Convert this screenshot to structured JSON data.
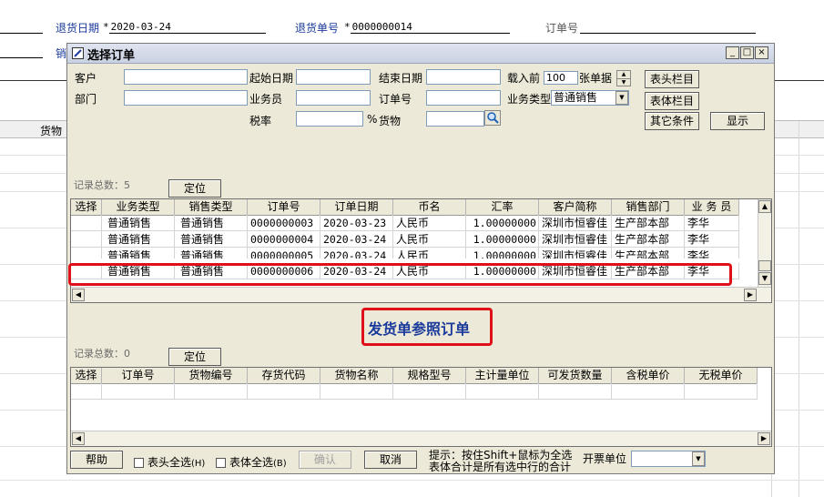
{
  "background_form": {
    "return_date_label": "退货日期",
    "return_date_value": "2020-03-24",
    "return_no_label": "退货单号",
    "return_no_value": "0000000014",
    "order_no_label": "订单号",
    "sales_label_partial": "销",
    "goods_col_label": "货物",
    "required_mark": "*"
  },
  "dialog": {
    "title": "选择订单",
    "window_buttons": [
      "_",
      "□",
      "×"
    ],
    "filters": {
      "customer_label": "客户",
      "customer_value": "",
      "ship_start_label": "起始日期",
      "ship_start_value": "",
      "end_date_label": "结束日期",
      "end_date_value": "",
      "load_prefix_label": "载入前",
      "load_count": "100",
      "load_suffix_label": "张单据",
      "department_label": "部门",
      "department_value": "",
      "salesperson_label": "业务员",
      "salesperson_value": "",
      "order_no_label": "订单号",
      "order_no_value": "",
      "business_type_label": "业务类型",
      "business_type_value": "普通销售",
      "tax_rate_label": "税率",
      "tax_rate_value": "",
      "percent": "%",
      "goods_label": "货物",
      "goods_value": ""
    },
    "buttons": {
      "header_columns": "表头栏目",
      "body_columns": "表体栏目",
      "other_conditions": "其它条件",
      "show": "显示",
      "locate_top": "定位",
      "locate_bottom": "定位",
      "help": "帮助",
      "confirm": "确认",
      "cancel": "取消"
    },
    "top_record_count": "记录总数：5",
    "bottom_record_count": "记录总数：0",
    "top_grid": {
      "headers": [
        "选择",
        "业务类型",
        "销售类型",
        "订单号",
        "订单日期",
        "币名",
        "汇率",
        "客户简称",
        "销售部门",
        "业 务 员"
      ],
      "rows": [
        [
          "",
          "普通销售",
          "普通销售",
          "0000000003",
          "2020-03-23",
          "人民币",
          "1.00000000",
          "深圳市恒睿佳",
          "生产部本部",
          "李华"
        ],
        [
          "",
          "普通销售",
          "普通销售",
          "0000000004",
          "2020-03-24",
          "人民币",
          "1.00000000",
          "深圳市恒睿佳",
          "生产部本部",
          "李华"
        ],
        [
          "",
          "普通销售",
          "普通销售",
          "0000000005",
          "2020-03-24",
          "人民币",
          "1.00000000",
          "深圳市恒睿佳",
          "生产部本部",
          "李华"
        ],
        [
          "",
          "普通销售",
          "普通销售",
          "0000000006",
          "2020-03-24",
          "人民币",
          "1.00000000",
          "深圳市恒睿佳",
          "生产部本部",
          "李华"
        ]
      ]
    },
    "annotation": "发货单参照订单",
    "bottom_grid": {
      "headers": [
        "选择",
        "订单号",
        "货物编号",
        "存货代码",
        "货物名称",
        "规格型号",
        "主计量单位",
        "可发货数量",
        "含税单价",
        "无税单价"
      ]
    },
    "footer": {
      "header_select_all": "表头全选",
      "header_select_all_key": "(H)",
      "body_select_all": "表体全选",
      "body_select_all_key": "(B)",
      "hint_line1": "提示：按住Shift+鼠标为全选",
      "hint_line2": "表体合计是所有选中行的合计",
      "invoice_unit_label": "开票单位",
      "invoice_unit_value": ""
    }
  },
  "colors": {
    "highlight": "#e0101a",
    "annotation_text": "#1a3a9c",
    "dialog_bg": "#ece9d8"
  }
}
